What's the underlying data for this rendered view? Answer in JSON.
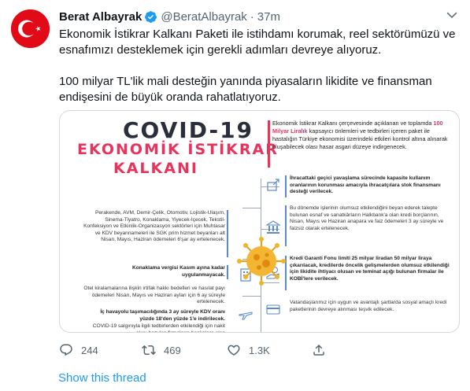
{
  "tweet": {
    "author_name": "Berat Albayrak",
    "handle": "@BeratAlbayrak",
    "separator": "·",
    "time": "37m",
    "verified": true,
    "paragraph_1": "Ekonomik İstikrar Kalkanı Paketi ile istihdamı korumak, reel sektörümüzü ve esnafımızı desteklemek için gerekli adımları devreye alıyoruz.",
    "paragraph_2": "100 milyar TL'lik mali desteğin yanında piyasaların likidite ve finansman endişesini de büyük oranda rahatlatıyoruz."
  },
  "infographic": {
    "title_line_1": "COVID-19",
    "title_line_2": "EKONOMİK İSTİKRAR",
    "title_line_3": "KALKANI",
    "intro_pre": "Ekonomik İstikrar Kalkanı çerçevesinde açıklanan ve toplamda ",
    "intro_highlight": "100 Milyar Liralık",
    "intro_post": " kapsayıcı önlemleri ve tedbirleri içeren paket ile hastalığın Türkiye ekonomisi üzerindeki etkileri kontrol altına alınarak oluşabilecek olası hasar asgari düzeye indirgenecek.",
    "left_1": "Perakende, AVM, Demir-Çelik, Otomotiv, Lojistik-Ulaşım, Sinema-Tiyatro, Konaklama, Yiyecek-İçecek, Tekstil-Konfeksiyon ve Etkinlik-Organizasyon sektörleri için Muhtasar ve KDV beyannameleri ile SGK prim hizmet beyanları alt Nisan, Mayıs, Haziran ödemeleri 6'şar ay ertelenecek.",
    "left_2": "Konaklama vergisi Kasım ayına kadar uygulanmayacak.",
    "left_3": "Otel kiralamalarına ilişkin irtifak hakkı bedelleri ve hasılat payı ödemeleri Nisan, Mayıs ve Haziran ayları için 6 ay süreyle ertelenecek.",
    "left_4": "İç havayolu taşımacılığında 3 ay süreyle KDV oranı yüzde 18'den yüzde 1'e indirilecek.",
    "left_5": "COVID-19 salgınıyla ilgili tedbirlerden etkilendiği için nakit akışı bozulan firmaların bankalara olan",
    "right_1": "İhracattaki geçici yavaşlama sürecinde kapasite kullanım oranlarının korunması amacıyla ihracatçılara stok finansmanı desteği verilecek.",
    "right_2": "Bu dönemde işlerinin olumsuz etkilendiğini beyan ederek talepte bulunan esnaf ve sanatkârların Halkbank'a olan kredi borçlarının, Nisan, Mayıs ve Haziran anapara ve faiz ödemeleri 3 ay süreyle ve faizsiz olarak ertelenecek.",
    "right_3": "Kredi Garanti Fonu limiti 25 milyar liradan 50 milyar liraya çıkarılacak, kredilerde öncelik gelişmelerden olumsuz etkilendiği için likidite ihtiyacı olusan ve teminat açığı bulunan firmalar ile KOBİ'lere verilecek.",
    "right_4": "Vatandaşlarımız için uygun ve avantajlı şartlarda sosyal amaçlı kredi paketlerinin devreye alınması teşvik edilecek."
  },
  "actions": {
    "reply_count": "244",
    "retweet_count": "469",
    "like_count": "1.3K"
  },
  "show_thread": "Show this thread",
  "colors": {
    "accent": "#1d9bf0",
    "infographic_pink": "#e8335d",
    "flag_red": "#e30a17"
  }
}
